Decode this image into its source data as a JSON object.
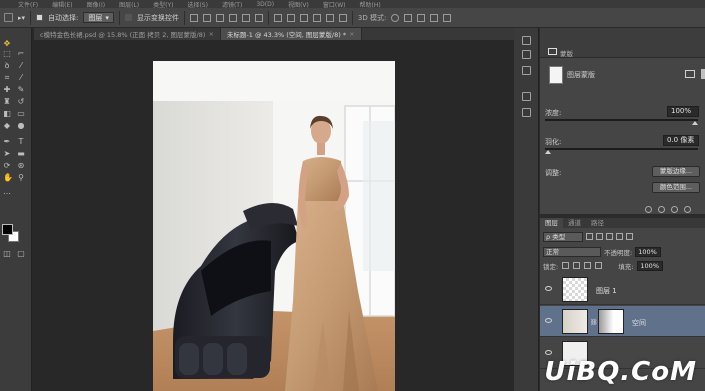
{
  "menubar": {
    "items": [
      "文件(F)",
      "编辑(E)",
      "图像(I)",
      "图层(L)",
      "类型(Y)",
      "选择(S)",
      "滤镜(T)",
      "3D(D)",
      "视图(V)",
      "窗口(W)",
      "帮助(H)"
    ]
  },
  "options_bar": {
    "auto_select_label": "自动选择:",
    "auto_select_value": "图层",
    "show_transform_label": "显示变换控件",
    "mode_3d_label": "3D 模式:"
  },
  "tabs": [
    {
      "label": "c模特金色长裙.psd @ 15.8% (正面 拷贝 2, 图层蒙版/8)",
      "active": false
    },
    {
      "label": "未标题-1 @ 43.3% (空间, 图层蒙版/8) *",
      "active": true
    }
  ],
  "properties": {
    "panel_title": "蒙版",
    "mask_title": "图层蒙版",
    "density_label": "浓度:",
    "density_value": "100%",
    "feather_label": "羽化:",
    "feather_value": "0.0 像素",
    "density_slider": 1.0,
    "feather_slider": 0.0,
    "adjust_label": "调整:",
    "mask_edge_button": "蒙版边缘...",
    "color_range_button": "颜色范围..."
  },
  "layers_panel": {
    "tabs": [
      {
        "label": "图层",
        "active": true
      },
      {
        "label": "通道",
        "active": false
      },
      {
        "label": "路径",
        "active": false
      }
    ],
    "filter_kind": "ρ 类型",
    "blend_mode": "正常",
    "opacity_label": "不透明度:",
    "opacity_value": "100%",
    "lock_label": "锁定:",
    "fill_label": "填充:",
    "fill_value": "100%",
    "layers": [
      {
        "name": "图层 1",
        "selected": false
      },
      {
        "name": "空间",
        "selected": true
      }
    ]
  },
  "watermark": "UiBQ.CoM",
  "colors": {
    "foreground": "#000000",
    "background": "#ffffff",
    "selection": "#60718c"
  }
}
